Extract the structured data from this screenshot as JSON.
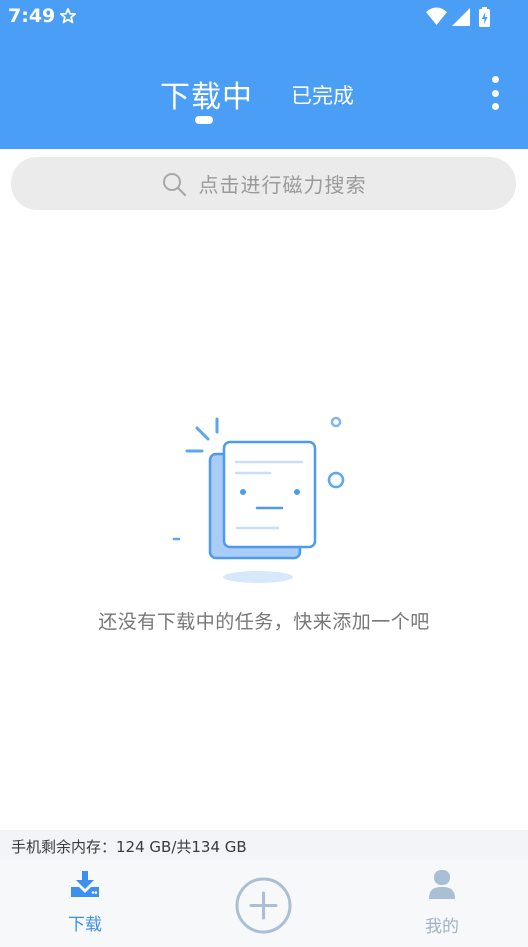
{
  "status_bar": {
    "time": "7:49",
    "icons": [
      "star-icon",
      "wifi-icon",
      "signal-icon",
      "battery-charging-icon"
    ]
  },
  "header": {
    "tabs": [
      {
        "label": "下载中",
        "active": true
      },
      {
        "label": "已完成",
        "active": false
      }
    ],
    "more_icon": "more-vertical-icon"
  },
  "search": {
    "placeholder": "点击进行磁力搜索",
    "icon": "search-icon"
  },
  "empty_state": {
    "icon": "empty-document-icon",
    "message": "还没有下载中的任务，快来添加一个吧"
  },
  "storage": {
    "text": "手机剩余内存：124 GB/共134 GB"
  },
  "bottom_nav": {
    "items": [
      {
        "label": "下载",
        "icon": "download-icon",
        "active": true
      },
      {
        "label": "",
        "icon": "add-circle-icon",
        "active": false
      },
      {
        "label": "我的",
        "icon": "user-icon",
        "active": false
      }
    ]
  },
  "colors": {
    "header_bg": "#4a9ef5",
    "accent": "#3d8ff0",
    "inactive": "#9fb3c8",
    "search_bg": "#ebebeb"
  }
}
